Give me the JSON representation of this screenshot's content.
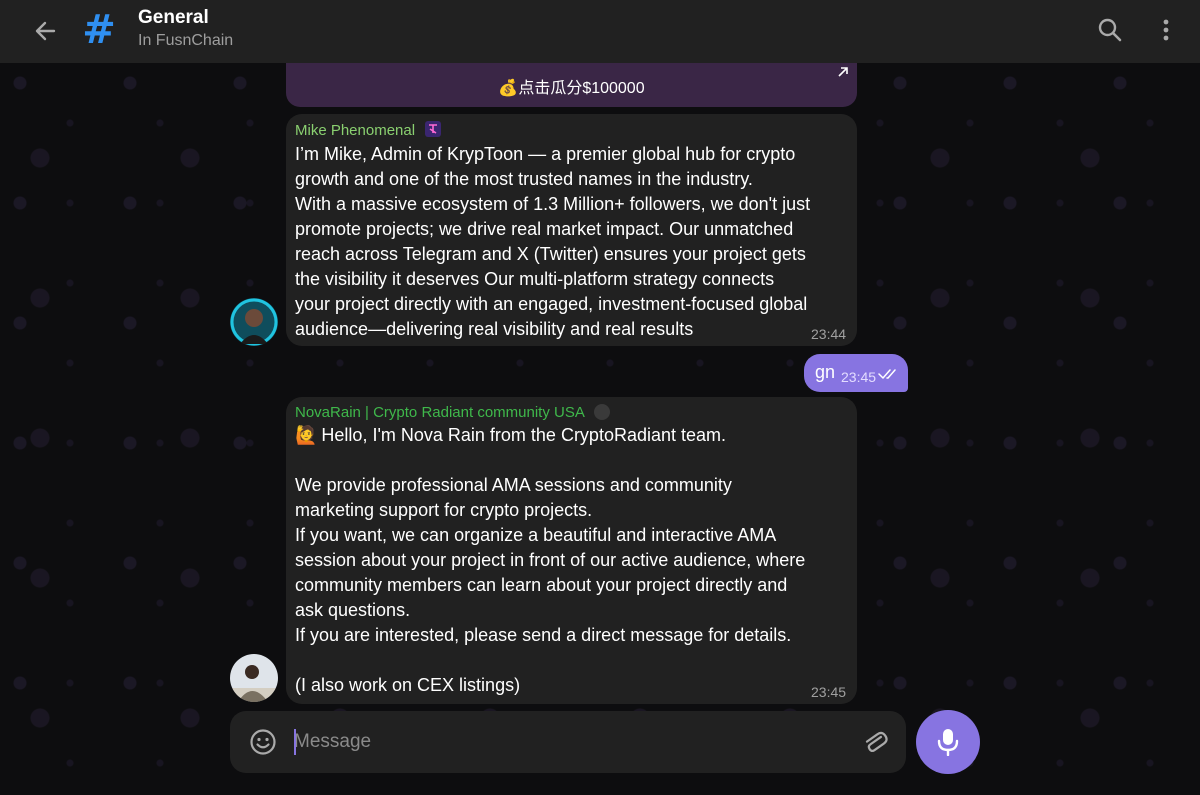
{
  "header": {
    "title": "General",
    "subtitle": "In FusnChain"
  },
  "promo": {
    "text": "💰点击瓜分$100000"
  },
  "messages": [
    {
      "sender": "Mike Phenomenal",
      "sender_color": "#8ad070",
      "lines": "I’m Mike, Admin of KrypToon — a premier global hub for crypto\ngrowth and one of the most trusted names in the industry.\nWith a massive ecosystem of 1.3 Million+ followers, we don't just\npromote projects; we drive real market impact. Our unmatched\nreach across Telegram and X (Twitter) ensures your project gets\nthe visibility it deserves Our multi-platform strategy connects\nyour project directly with an engaged, investment-focused global\naudience—delivering real visibility and real results",
      "time": "23:44"
    },
    {
      "outgoing": true,
      "text": "gn",
      "time": "23:45"
    },
    {
      "sender": "NovaRain | Crypto Radiant community USA",
      "sender_color": "#3fb84b",
      "lines": "Hello, I'm Nova Rain from the CryptoRadiant team.\n\nWe provide professional AMA sessions and community\nmarketing support for crypto projects.\nIf you want, we can organize a beautiful and interactive AMA\nsession about your project in front of our active audience, where\ncommunity members can learn about your project directly and\nask questions.\nIf you are interested, please send a direct message for details.\n\n(I also work on CEX listings)",
      "emoji": "🙋",
      "time": "23:45"
    }
  ],
  "composer": {
    "placeholder": "Message"
  },
  "colors": {
    "accent": "#8774e1",
    "header_bg": "#212121",
    "bubble_bg": "#212121",
    "channel_icon": "#2f8ff0"
  },
  "icons": [
    "back-arrow-icon",
    "hashtag-channel-icon",
    "search-icon",
    "more-vertical-icon",
    "emoji-smile-icon",
    "paperclip-icon",
    "microphone-icon",
    "double-check-icon",
    "external-link-icon"
  ]
}
